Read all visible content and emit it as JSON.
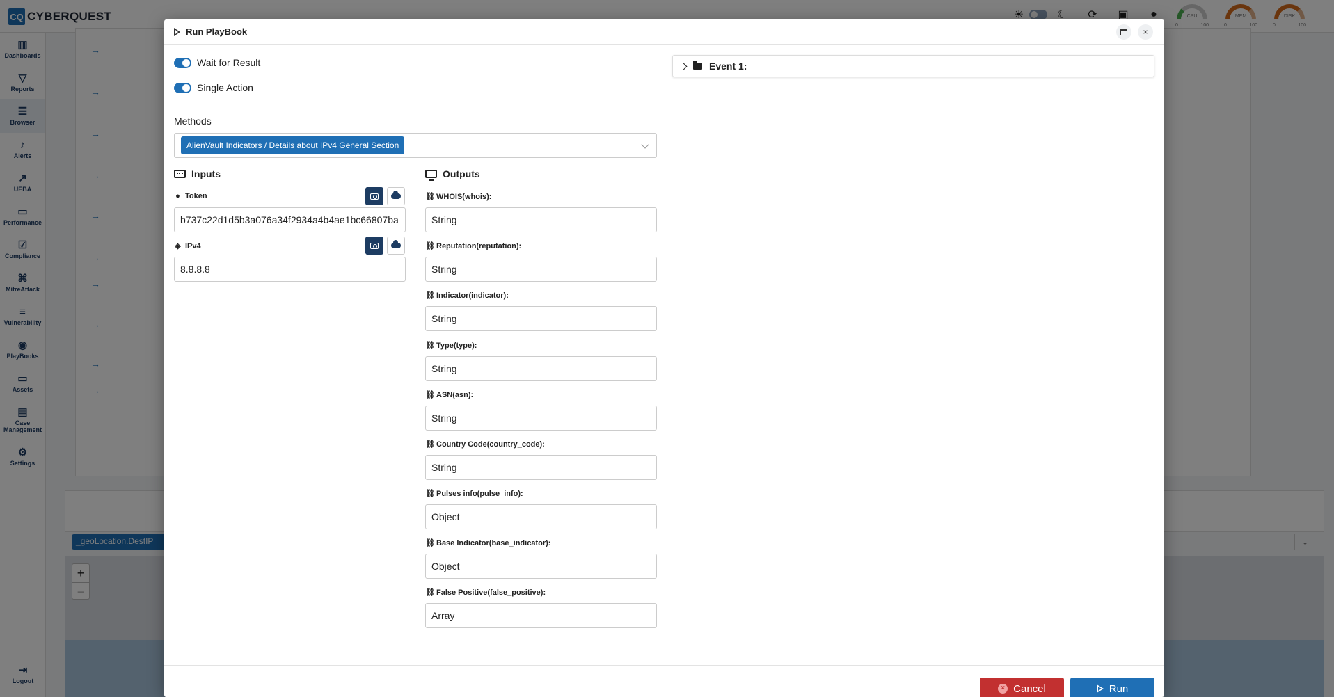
{
  "app": {
    "logo_mark": "CQ",
    "logo_text": "CYBERQUEST"
  },
  "gauges": [
    {
      "label": "CPU",
      "min": "0",
      "max": "100"
    },
    {
      "label": "MEM",
      "min": "0",
      "max": "100"
    },
    {
      "label": "DISK",
      "min": "0",
      "max": "100"
    }
  ],
  "sidebar": {
    "items": [
      {
        "label": "Dashboards",
        "icon": "chart-icon"
      },
      {
        "label": "Reports",
        "icon": "filter-icon"
      },
      {
        "label": "Browser",
        "icon": "list-icon"
      },
      {
        "label": "Alerts",
        "icon": "bell-icon"
      },
      {
        "label": "UEBA",
        "icon": "trend-icon"
      },
      {
        "label": "Performance",
        "icon": "performance-icon"
      },
      {
        "label": "Compliance",
        "icon": "compliance-icon"
      },
      {
        "label": "MitreAttack",
        "icon": "command-icon"
      },
      {
        "label": "Vulnerability",
        "icon": "vulnerability-icon"
      },
      {
        "label": "PlayBooks",
        "icon": "playbook-icon"
      },
      {
        "label": "Assets",
        "icon": "laptop-icon"
      },
      {
        "label": "Case Management",
        "icon": "briefcase-icon"
      },
      {
        "label": "Settings",
        "icon": "gear-icon"
      }
    ],
    "logout": "Logout"
  },
  "background": {
    "chip": "_geoLocation.DestIP",
    "zoom_in": "+",
    "zoom_out": "−"
  },
  "modal": {
    "title": "Run PlayBook",
    "close_glyph": "×",
    "wait_for_result": "Wait for Result",
    "single_action": "Single Action",
    "methods_label": "Methods",
    "method_selected": "AlienVault Indicators / Details about IPv4 General Section",
    "inputs_title": "Inputs",
    "outputs_title": "Outputs",
    "inputs": [
      {
        "label": "Token",
        "value": "b737c22d1d5b3a076a34f2934a4b4ae1bc66807ba"
      },
      {
        "label": "IPv4",
        "value": "8.8.8.8"
      }
    ],
    "outputs": [
      {
        "label": "WHOIS(whois):",
        "value": "String"
      },
      {
        "label": "Reputation(reputation):",
        "value": "String"
      },
      {
        "label": "Indicator(indicator):",
        "value": "String"
      },
      {
        "label": "Type(type):",
        "value": "String"
      },
      {
        "label": "ASN(asn):",
        "value": "String"
      },
      {
        "label": "Country Code(country_code):",
        "value": "String"
      },
      {
        "label": "Pulses info(pulse_info):",
        "value": "Object"
      },
      {
        "label": "Base Indicator(base_indicator):",
        "value": "Object"
      },
      {
        "label": "False Positive(false_positive):",
        "value": "Array"
      }
    ],
    "event_label": "Event 1:",
    "cancel_label": "Cancel",
    "run_label": "Run"
  }
}
